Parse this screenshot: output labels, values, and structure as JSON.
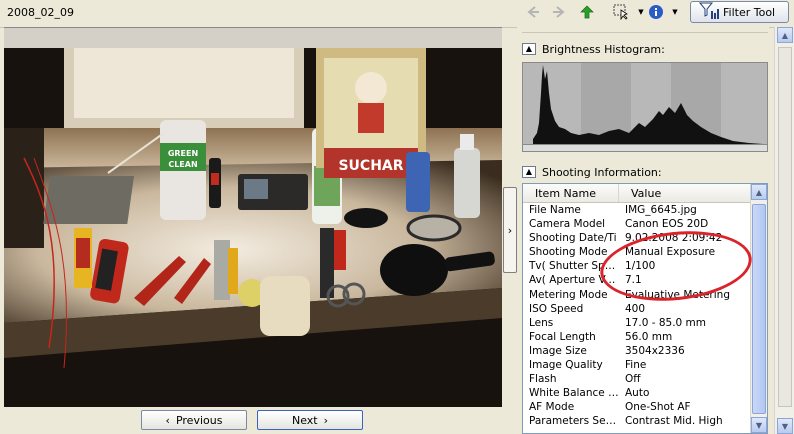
{
  "toolbar": {
    "folder_title": "2008_02_09",
    "filter_label": "Filter Tool",
    "icons": [
      "back-arrow-icon",
      "forward-arrow-icon",
      "up-folder-icon",
      "select-icon",
      "info-icon"
    ]
  },
  "navigation": {
    "previous_label": "Previous",
    "next_label": "Next"
  },
  "sections": {
    "histogram_title": "Brightness Histogram:",
    "shooting_title": "Shooting Information:"
  },
  "table": {
    "col_name": "Item Name",
    "col_value": "Value",
    "rows": [
      {
        "name": "File Name",
        "value": "IMG_6645.jpg"
      },
      {
        "name": "Camera Model",
        "value": "Canon EOS 20D"
      },
      {
        "name": "Shooting Date/Ti",
        "value": "9.02.2008 2:09:42"
      },
      {
        "name": "Shooting Mode",
        "value": "Manual Exposure"
      },
      {
        "name": "Tv( Shutter Spee...",
        "value": "1/100"
      },
      {
        "name": "Av( Aperture Valu...",
        "value": "7.1"
      },
      {
        "name": "Metering Mode",
        "value": "Evaluative Metering"
      },
      {
        "name": "ISO Speed",
        "value": "400"
      },
      {
        "name": "Lens",
        "value": "17.0 - 85.0 mm"
      },
      {
        "name": "Focal Length",
        "value": "56.0 mm"
      },
      {
        "name": "Image Size",
        "value": "3504x2336"
      },
      {
        "name": "Image Quality",
        "value": "Fine"
      },
      {
        "name": "Flash",
        "value": "Off"
      },
      {
        "name": "White Balance M...",
        "value": "Auto"
      },
      {
        "name": "AF Mode",
        "value": "One-Shot AF"
      },
      {
        "name": "Parameters Settin...",
        "value": "Contrast  Mid. High"
      }
    ]
  },
  "photo_text": {
    "cleaner_label_1": "GREEN",
    "cleaner_label_2": "CLEAN",
    "poster_text": "SUCHAR"
  },
  "colors": {
    "annotation": "#d9242b",
    "accent_green": "#2aa02a",
    "info_blue": "#2a5cc8"
  }
}
